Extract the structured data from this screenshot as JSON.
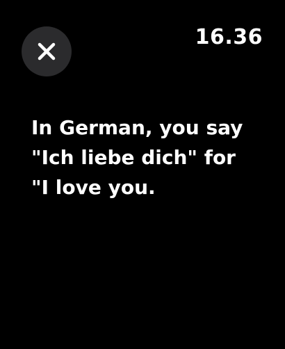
{
  "status_bar": {
    "time": "16.36"
  },
  "controls": {
    "close_icon": "close-icon"
  },
  "content": {
    "line1": "In German, you say",
    "line2": "\"Ich liebe dich\" for",
    "line3": "\"I love you."
  },
  "colors": {
    "background": "#000000",
    "text": "#ffffff",
    "button_background": "#2b2b2d"
  }
}
